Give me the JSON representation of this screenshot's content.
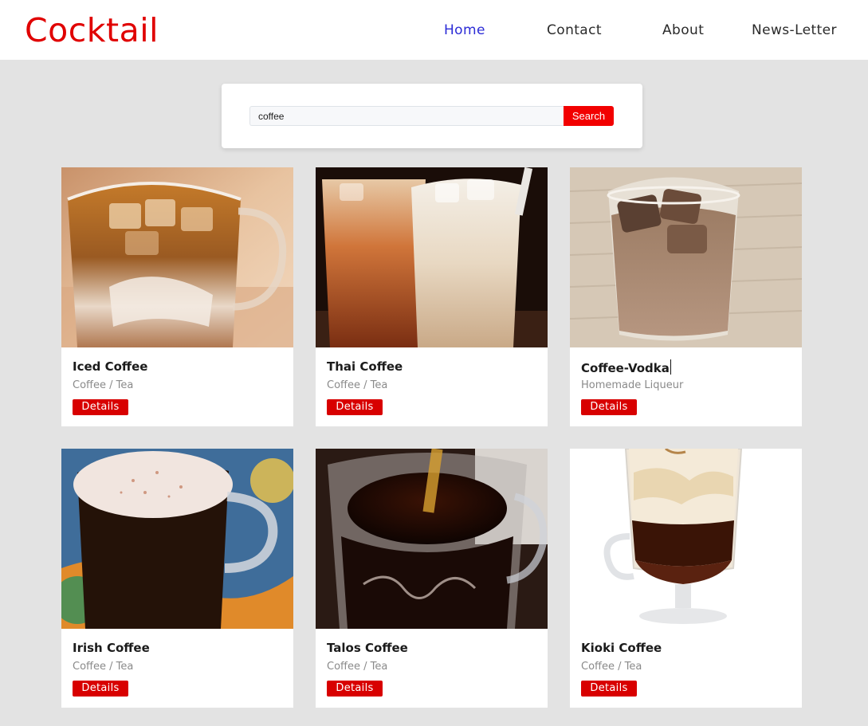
{
  "brand": "Cocktail",
  "nav": {
    "home": "Home",
    "contact": "Contact",
    "about": "About",
    "newsletter": "News-Letter"
  },
  "search": {
    "value": "coffee",
    "button_label": "Search"
  },
  "drinks": [
    {
      "name": "Iced Coffee",
      "category": "Coffee / Tea",
      "button": "Details"
    },
    {
      "name": "Thai Coffee",
      "category": "Coffee / Tea",
      "button": "Details"
    },
    {
      "name": "Coffee-Vodka",
      "category": "Homemade Liqueur",
      "button": "Details"
    },
    {
      "name": "Irish Coffee",
      "category": "Coffee / Tea",
      "button": "Details"
    },
    {
      "name": "Talos Coffee",
      "category": "Coffee / Tea",
      "button": "Details"
    },
    {
      "name": "Kioki Coffee",
      "category": "Coffee / Tea",
      "button": "Details"
    }
  ],
  "colors": {
    "brand": "#e00000",
    "active_nav": "#2b2bd6",
    "button": "#d80000",
    "page_background": "#e3e3e3"
  }
}
